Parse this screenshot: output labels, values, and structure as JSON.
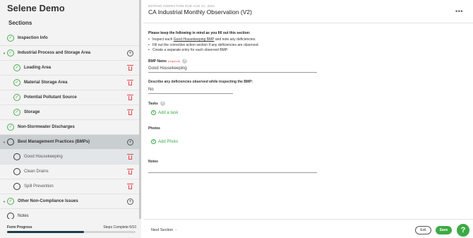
{
  "app": {
    "title": "Selene Demo"
  },
  "sidebar": {
    "sections_title": "Sections",
    "items": [
      {
        "label": "Inspection Info"
      },
      {
        "label": "Industrial Process and Storage Area"
      },
      {
        "label": "Loading Area"
      },
      {
        "label": "Material Storage Area"
      },
      {
        "label": "Potential Pollutant Source"
      },
      {
        "label": "Storage"
      },
      {
        "label": "Non-Stormwater Discharges"
      },
      {
        "label": "Best Management Practices (BMPs)"
      },
      {
        "label": "Good Housekeeping"
      },
      {
        "label": "Clean Drains"
      },
      {
        "label": "Spill Prevention"
      },
      {
        "label": "Other Non-Compliance Issues"
      },
      {
        "label": "Notes"
      }
    ],
    "progress": {
      "label": "Form Progress",
      "steps_text": "Steps Complete 6/10",
      "fraction": 0.6
    }
  },
  "header": {
    "due_text": "EDITING INSPECTION DUE AUG 31, 2021",
    "form_title": "CA Industrial Monthly Observation (V2)",
    "more_icon": "ellipsis-icon"
  },
  "instructions": {
    "title": "Please keep the following in mind as you fill out this section:",
    "line1_prefix": "Inspect each ",
    "line1_link": "Good Housekeeping BMP",
    "line1_suffix": " and note any deficiencies.",
    "line2": "Fill out the corrective action section if any deficiencies are observed.",
    "line3": "Create a separate entry for each observed BMP."
  },
  "form": {
    "bmp_name_label": "BMP Name",
    "required_text": "(required)",
    "bmp_name_value": "Good Housekeeping",
    "deficiencies_label": "Describe any deficiencies observed while inspecting the BMP:",
    "deficiencies_value": "No",
    "tasks_label": "Tasks",
    "add_task_label": "Add a task",
    "photos_label": "Photos",
    "add_photo_label": "Add Photo",
    "notes_label": "Notes"
  },
  "footer": {
    "next_section_label": "Next Section",
    "exit_label": "Exit",
    "save_label": "Save",
    "help_label": "?"
  },
  "colors": {
    "accent": "#3daa45",
    "danger": "#e04848",
    "progress": "#1e3a4c"
  }
}
